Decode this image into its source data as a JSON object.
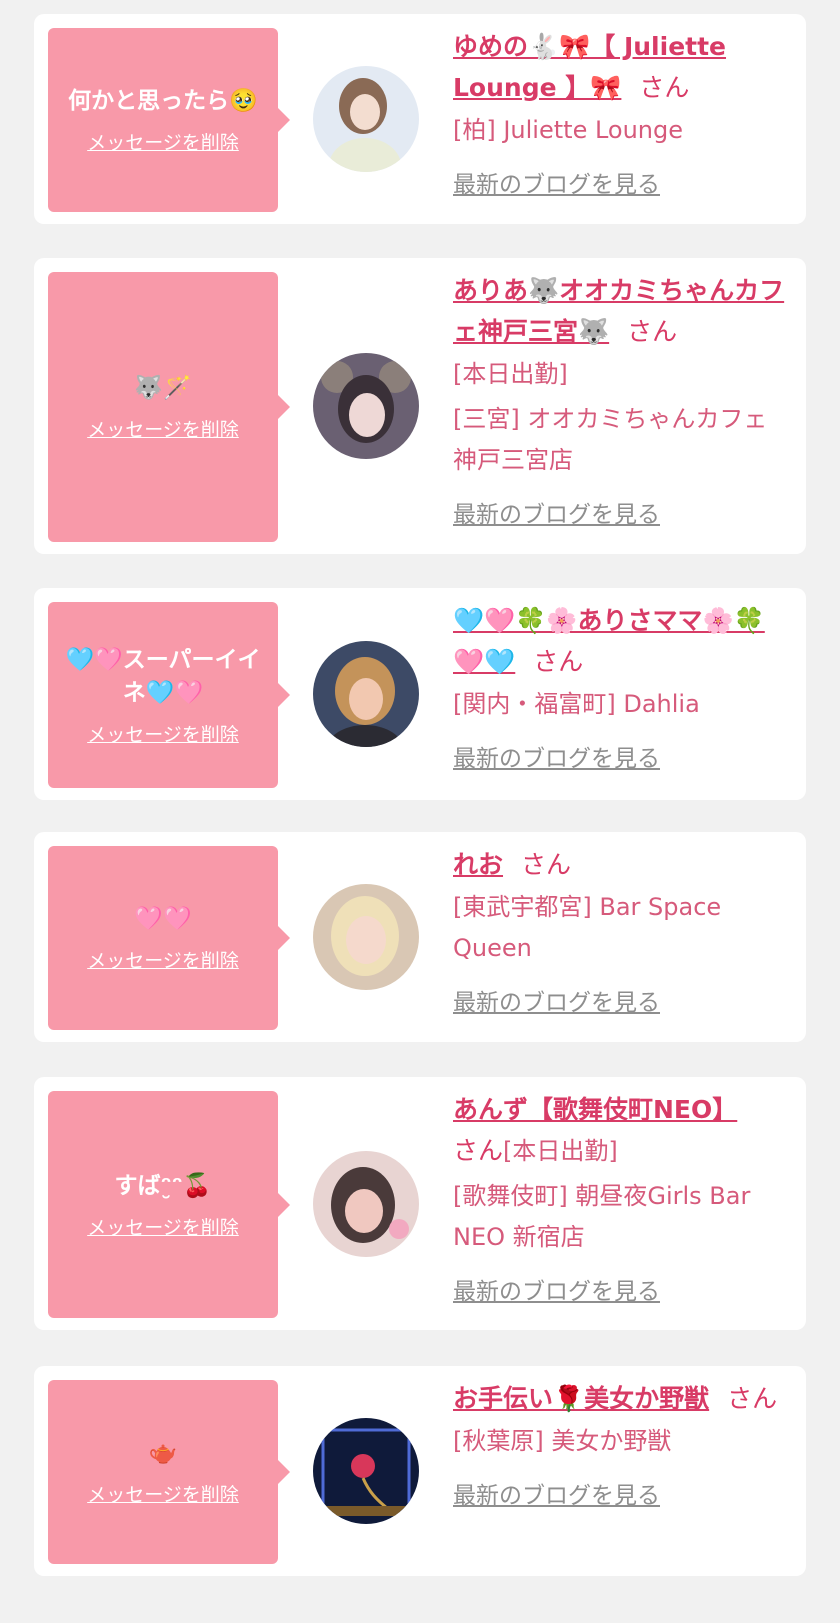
{
  "delete_label": "メッセージを削除",
  "blog_label": "最新のブログを見る",
  "san_label": "さん",
  "colors": {
    "bubble": "#f899a9",
    "name": "#d83b66",
    "location": "#d65a7b",
    "link_gray": "#8e8e8e"
  },
  "cards": [
    {
      "message": "何かと思ったら🥹",
      "name": "ゆめの🐇🎀【 Juliette Lounge 】🎀",
      "san": "さん",
      "status": "",
      "location": "[柏] Juliette Lounge"
    },
    {
      "message": "🐺🪄",
      "name": "ありあ🐺オオカミちゃんカフェ神戸三宮🐺",
      "san": "さん",
      "status": "[本日出勤]",
      "location": "[三宮] オオカミちゃんカフェ神戸三宮店"
    },
    {
      "message": "🩵🩷スーパーイイネ🩵🩷",
      "name": "🩵🩷🍀🌸ありさママ🌸🍀🩷🩵",
      "san": "さん",
      "status": "",
      "location": "[関内・福富町] Dahlia"
    },
    {
      "message": "🩷🩷",
      "name": "れお",
      "san": "さん",
      "status": "",
      "location": "[東武宇都宮] Bar Space Queen"
    },
    {
      "message": "すばᵔ̮ᵔ🍒",
      "name": "あんず【歌舞伎町NEO】",
      "san": "さん",
      "status": "[本日出勤]",
      "location": "[歌舞伎町] 朝昼夜Girls Bar NEO 新宿店"
    },
    {
      "message": "🫖",
      "name": "お手伝い🌹美女か野獣",
      "san": "さん",
      "status": "",
      "location": "[秋葉原] 美女か野獣"
    }
  ]
}
